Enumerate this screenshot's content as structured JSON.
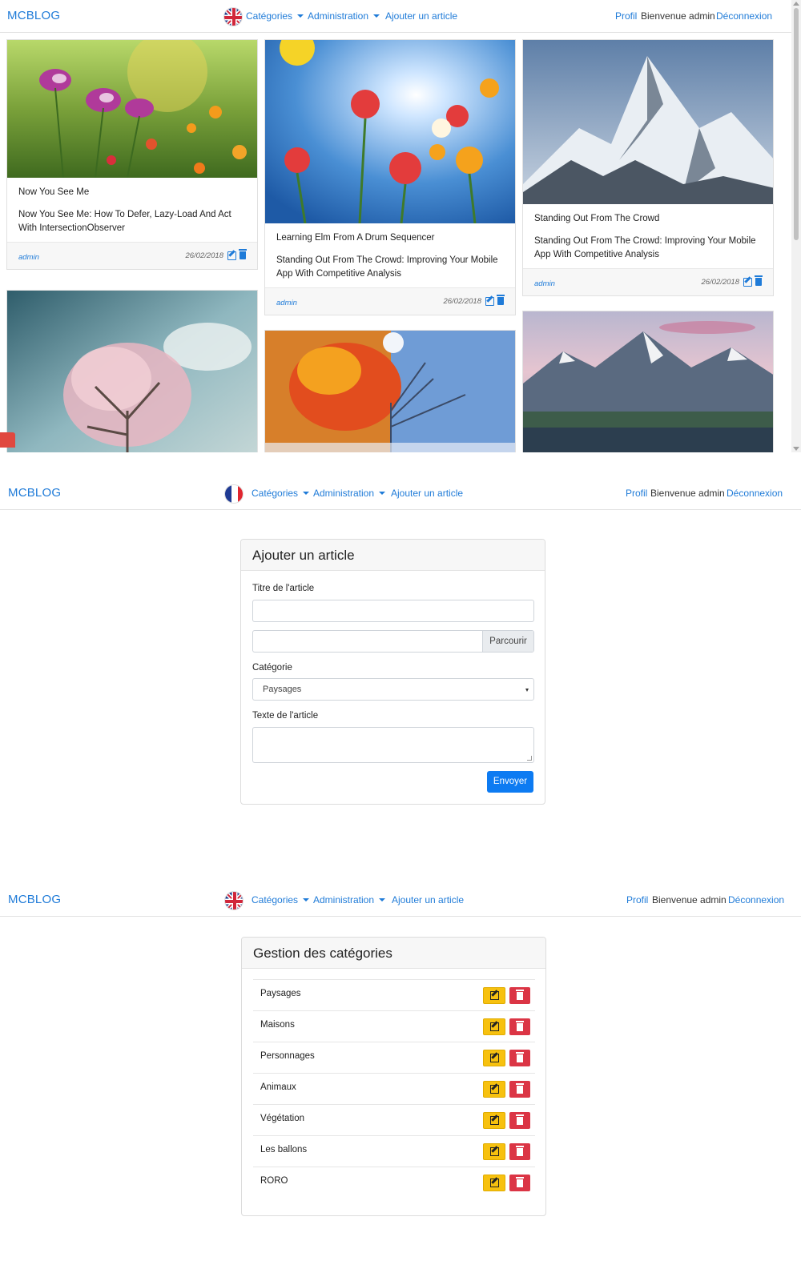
{
  "colors": {
    "link": "#1f7bd8",
    "primary": "#0d7bf2",
    "warning": "#f7c10f",
    "danger": "#db3545"
  },
  "navbar": {
    "brand": "MCBLOG",
    "categories_label": "Catégories",
    "administration_label": "Administration",
    "add_article_label": "Ajouter un article",
    "profile_label": "Profil",
    "welcome_text": "Bienvenue admin",
    "logout_label": "Déconnexion"
  },
  "panel1": {
    "flag": "uk-flag-icon",
    "articles": [
      {
        "title": "Now You See Me",
        "text": "Now You See Me: How To Defer, Lazy-Load And Act With IntersectionObserver",
        "author": "admin",
        "date": "26/02/2018",
        "image": "pink-cosmos-flowers"
      },
      {
        "title": "Learning Elm From A Drum Sequencer",
        "text": "Standing Out From The Crowd: Improving Your Mobile App With Competitive Analysis",
        "author": "admin",
        "date": "26/02/2018",
        "image": "red-flowers-sunny-sky"
      },
      {
        "title": "Standing Out From The Crowd",
        "text": "Standing Out From The Crowd: Improving Your Mobile App With Competitive Analysis",
        "author": "admin",
        "date": "26/02/2018",
        "image": "snowy-mountain-peak"
      },
      {
        "image": "blossoming-tree-sky"
      },
      {
        "image": "autumn-winter-tree"
      },
      {
        "image": "mountain-lake-sunset"
      }
    ]
  },
  "panel2": {
    "flag": "fr-flag-icon",
    "form": {
      "header": "Ajouter un article",
      "title_label": "Titre de l'article",
      "browse_label": "Parcourir",
      "category_label": "Catégorie",
      "category_value": "Paysages",
      "text_label": "Texte de l'article",
      "submit_label": "Envoyer"
    }
  },
  "panel3": {
    "flag": "uk-flag-icon",
    "header": "Gestion des catégories",
    "categories": [
      "Paysages",
      "Maisons",
      "Personnages",
      "Animaux",
      "Végétation",
      "Les ballons",
      "RORO"
    ]
  }
}
